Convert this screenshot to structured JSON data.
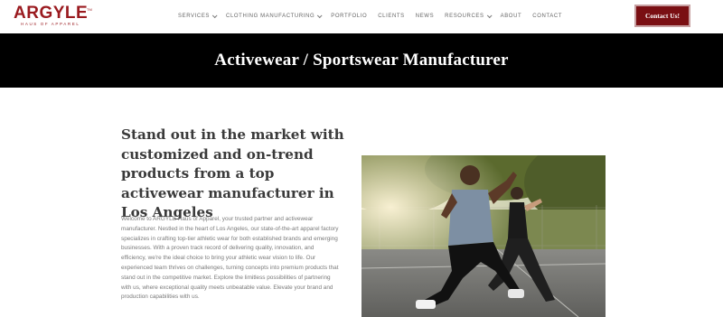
{
  "brand": {
    "name": "ARGYLE",
    "tagline": "HAUS OF APPAREL",
    "trademark": "TM",
    "color": "#9a1a1f"
  },
  "nav": {
    "items": [
      {
        "label": "SERVICES",
        "has_dropdown": true
      },
      {
        "label": "CLOTHING MANUFACTURING",
        "has_dropdown": true
      },
      {
        "label": "PORTFOLIO",
        "has_dropdown": false
      },
      {
        "label": "CLIENTS",
        "has_dropdown": false
      },
      {
        "label": "NEWS",
        "has_dropdown": false
      },
      {
        "label": "RESOURCES",
        "has_dropdown": true
      },
      {
        "label": "ABOUT",
        "has_dropdown": false
      },
      {
        "label": "CONTACT",
        "has_dropdown": false
      }
    ],
    "cta_label": "Contact Us!"
  },
  "banner": {
    "title": "Activewear / Sportswear Manufacturer"
  },
  "main": {
    "headline": "Stand out in the market with customized and on-trend products from a top activewear manufacturer in Los Angeles",
    "body": "Welcome to ARGYLE Haus of Apparel, your trusted partner and activewear manufacturer. Nestled in the heart of Los Angeles, our state-of-the-art apparel factory specializes in crafting top-tier athletic wear for both established brands and emerging businesses. With a proven track record of delivering quality, innovation, and efficiency, we're the ideal choice to bring your athletic wear vision to life. Our experienced team thrives on challenges, turning concepts into premium products that stand out in the competitive market. Explore the limitless possibilities of partnering with us, where exceptional quality meets unbeatable value. Elevate your brand and production capabilities with us."
  },
  "colors": {
    "cta_background": "#7a0f13",
    "banner_background": "#000000"
  }
}
